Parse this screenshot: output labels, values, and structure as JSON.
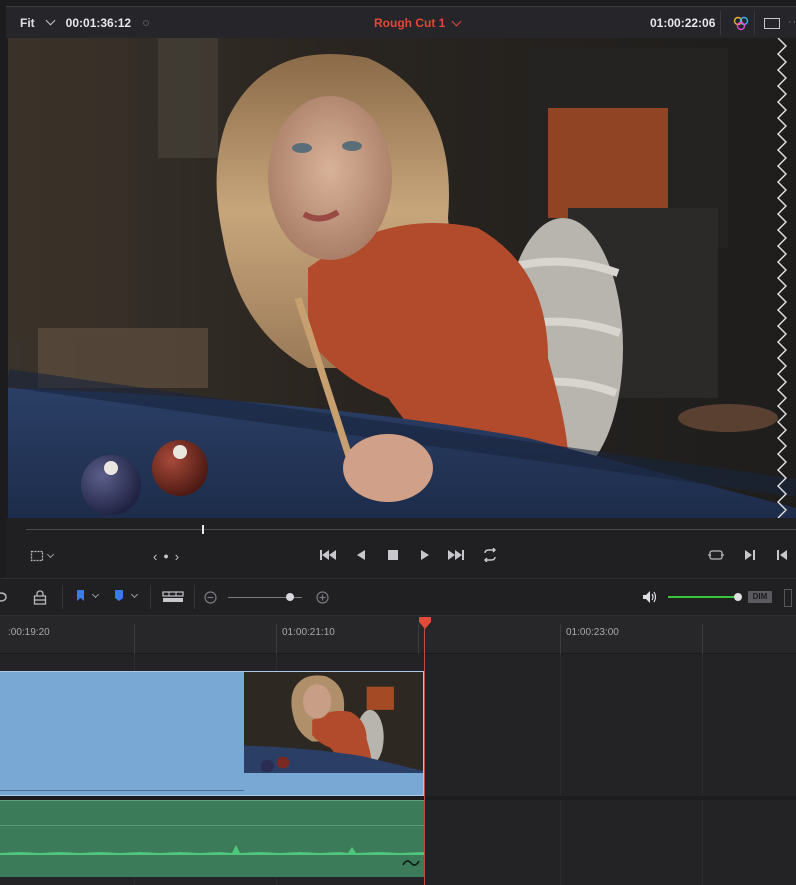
{
  "viewer": {
    "zoom": "Fit",
    "source_timecode": "00:01:36:12",
    "timeline_name": "Rough Cut 1",
    "record_timecode": "01:00:22:06"
  },
  "icons": {
    "header": [
      "chevron-down-icon",
      "color-scope-icon",
      "viewer-window-icon",
      "more-options-icon"
    ],
    "transport": [
      "crop-icon",
      "chevron-down-icon",
      "prev-edit-icon",
      "dot-icon",
      "next-edit-icon",
      "go-to-start-icon",
      "play-reverse-icon",
      "stop-icon",
      "play-icon",
      "go-to-end-icon",
      "loop-icon",
      "match-frame-icon",
      "play-to-out-icon",
      "play-to-in-icon"
    ],
    "toolbar": [
      "lock-icon",
      "flag-icon",
      "marker-icon",
      "track-height-icon",
      "zoom-out-icon",
      "zoom-in-icon",
      "speaker-icon"
    ]
  },
  "transport": {
    "nav_left": "‹",
    "nav_dot": "●",
    "nav_right": "›"
  },
  "toolbar": {
    "dim_label": "DIM",
    "flag_color": "#3a7bea",
    "marker_color": "#3a7bea",
    "volume_color": "#3ac43a",
    "volume_level": 0.65
  },
  "ruler": {
    "labels": [
      ":00:19:20",
      "01:00:21:10",
      "01:00:23:00"
    ]
  },
  "colors": {
    "timeline_name": "#e2473a",
    "playhead": "#e24a3a",
    "video_clip": "#7aa8d4",
    "audio_clip": "#3b7b59",
    "waveform": "#4ec77a"
  }
}
